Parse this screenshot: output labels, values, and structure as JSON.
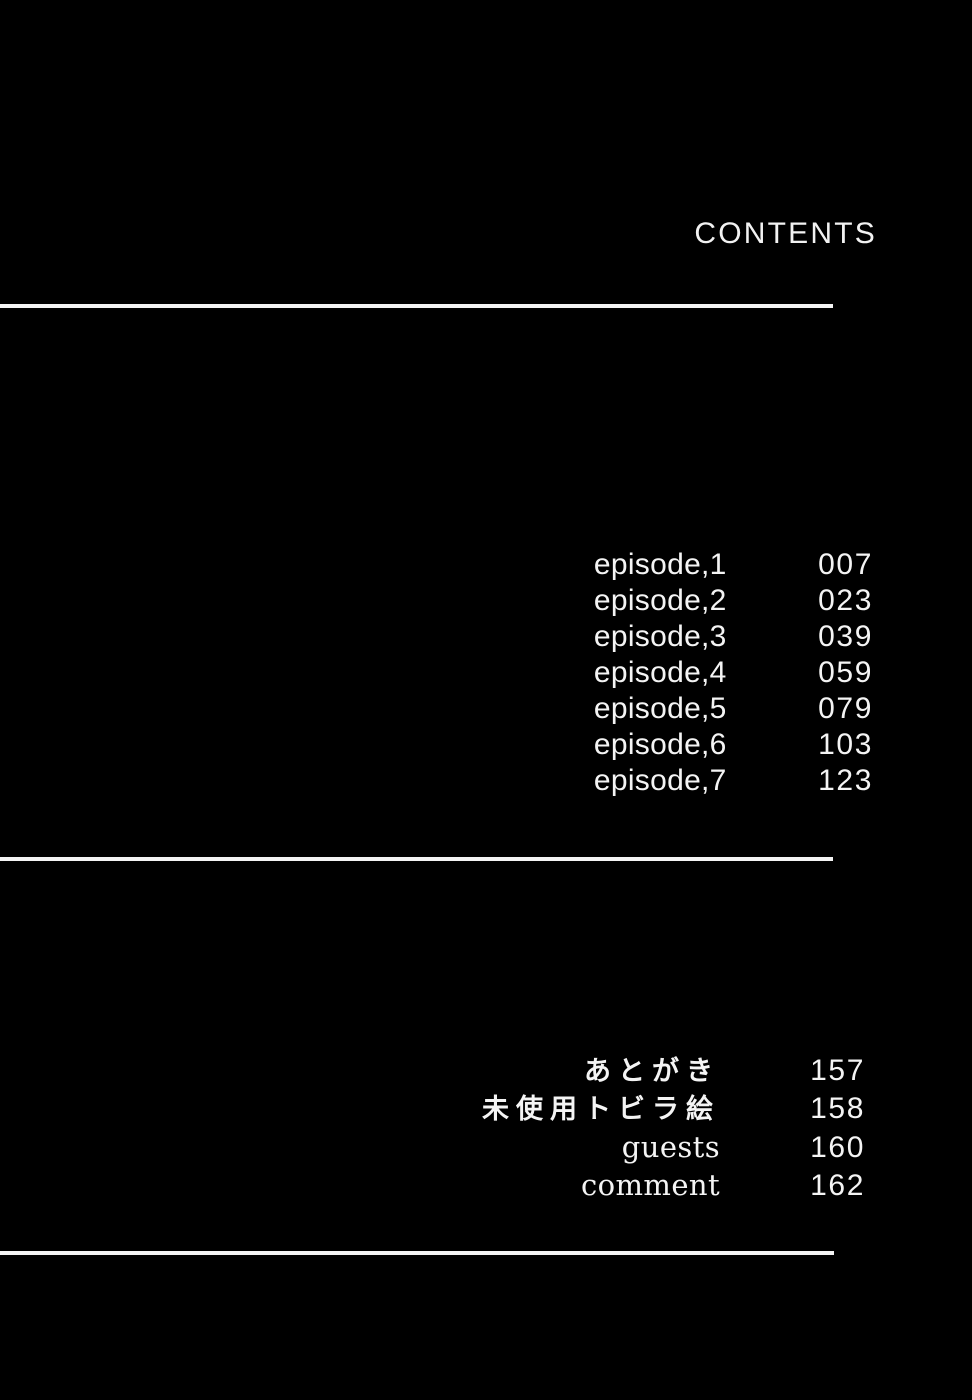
{
  "page": {
    "background_color": "#000000",
    "text_color": "#f4f4f4",
    "title": "CONTENTS"
  },
  "rules": {
    "top_label": "divider-top",
    "middle_label": "divider-middle",
    "bottom_label": "divider-bottom"
  },
  "episodes": [
    {
      "label": "episode,1",
      "page": "007"
    },
    {
      "label": "episode,2",
      "page": "023"
    },
    {
      "label": "episode,3",
      "page": "039"
    },
    {
      "label": "episode,4",
      "page": "059"
    },
    {
      "label": "episode,5",
      "page": "079"
    },
    {
      "label": "episode,6",
      "page": "103"
    },
    {
      "label": "episode,7",
      "page": "123"
    }
  ],
  "backmatter": [
    {
      "label": "あとがき",
      "page": "157",
      "script": "jp"
    },
    {
      "label": "未使用トビラ絵",
      "page": "158",
      "script": "jp"
    },
    {
      "label": "guests",
      "page": "160",
      "script": "latin"
    },
    {
      "label": "comment",
      "page": "162",
      "script": "latin"
    }
  ]
}
